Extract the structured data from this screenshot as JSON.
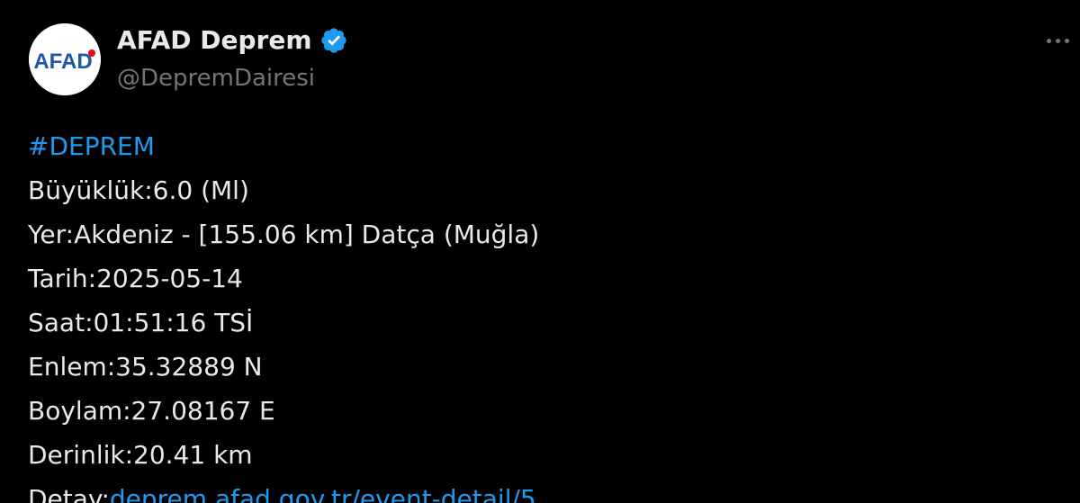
{
  "author": {
    "display_name": "AFAD Deprem",
    "handle": "@DepremDairesi",
    "avatar_text": "AFAD",
    "verified_icon": "verified-badge-icon",
    "avatar_colors": {
      "text": "#1e57a5",
      "accent": "#e30613",
      "background": "#ffffff"
    }
  },
  "menu": {
    "icon": "more-options-icon"
  },
  "tweet": {
    "hashtag": "#DEPREM",
    "lines": [
      "Büyüklük:6.0 (Ml)",
      "Yer:Akdeniz - [155.06 km] Datça (Muğla)",
      "Tarih:2025-05-14",
      "Saat:01:51:16 TSİ",
      "Enlem:35.32889 N",
      "Boylam:27.08167 E",
      "Derinlik:20.41 km"
    ],
    "detail_label": "Detay:",
    "detail_link": "deprem.afad.gov.tr/event-detail/5"
  },
  "colors": {
    "background": "#000000",
    "text": "#e7e9ea",
    "secondary_text": "#71767b",
    "link": "#1d9bf0"
  }
}
